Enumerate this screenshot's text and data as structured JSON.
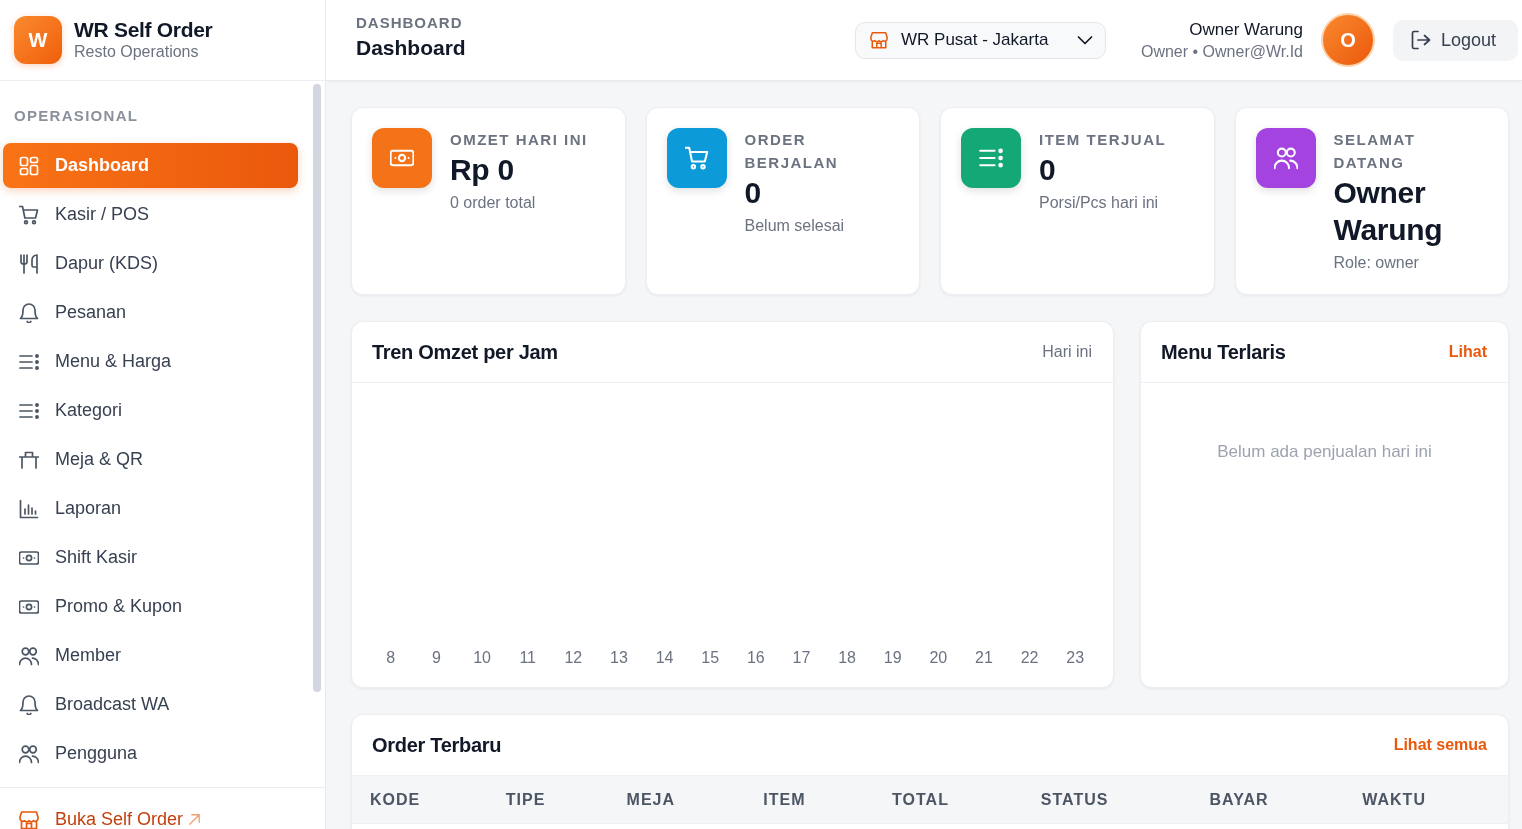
{
  "sidebar": {
    "brand": {
      "logo_letter": "W",
      "title": "WR Self Order",
      "subtitle": "Resto Operations"
    },
    "section_label": "OPERASIONAL",
    "items": [
      {
        "label": "Dashboard",
        "selected": true
      },
      {
        "label": "Kasir / POS",
        "selected": false
      },
      {
        "label": "Dapur (KDS)",
        "selected": false
      },
      {
        "label": "Pesanan",
        "selected": false
      },
      {
        "label": "Menu & Harga",
        "selected": false
      },
      {
        "label": "Kategori",
        "selected": false
      },
      {
        "label": "Meja & QR",
        "selected": false
      },
      {
        "label": "Laporan",
        "selected": false
      },
      {
        "label": "Shift Kasir",
        "selected": false
      },
      {
        "label": "Promo & Kupon",
        "selected": false
      },
      {
        "label": "Member",
        "selected": false
      },
      {
        "label": "Broadcast WA",
        "selected": false
      },
      {
        "label": "Pengguna",
        "selected": false
      }
    ],
    "footer_link": {
      "label": "Buka Self Order"
    }
  },
  "topbar": {
    "breadcrumb": "DASHBOARD",
    "title": "Dashboard",
    "branch_select": {
      "value": "WR Pusat - Jakarta"
    },
    "user": {
      "name": "Owner Warung",
      "detail": "Owner • Owner@Wr.Id",
      "avatar_initial": "O"
    },
    "logout_button": "Logout"
  },
  "stats": [
    {
      "label": "OMZET HARI INI",
      "value": "Rp 0",
      "note": "0 order total",
      "color": "#f47319"
    },
    {
      "label": "ORDER BERJALAN",
      "value": "0",
      "note": "Belum selesai",
      "color": "#0c9ad9"
    },
    {
      "label": "ITEM TERJUAL",
      "value": "0",
      "note": "Porsi/Pcs hari ini",
      "color": "#13a875"
    },
    {
      "label": "SELAMAT DATANG",
      "value": "Owner Warung",
      "note": "Role: owner",
      "color": "#a443e0"
    }
  ],
  "revenue_chart": {
    "title": "Tren Omzet per Jam",
    "range_label": "Hari ini",
    "hour_labels": [
      "8",
      "9",
      "10",
      "11",
      "12",
      "13",
      "14",
      "15",
      "16",
      "17",
      "18",
      "19",
      "20",
      "21",
      "22",
      "23"
    ]
  },
  "top_menu": {
    "title": "Menu Terlaris",
    "link": "Lihat",
    "empty_message": "Belum ada penjualan hari ini"
  },
  "recent_orders": {
    "title": "Order Terbaru",
    "link": "Lihat semua",
    "columns": [
      "KODE",
      "TIPE",
      "MEJA",
      "ITEM",
      "TOTAL",
      "STATUS",
      "BAYAR",
      "WAKTU"
    ]
  }
}
